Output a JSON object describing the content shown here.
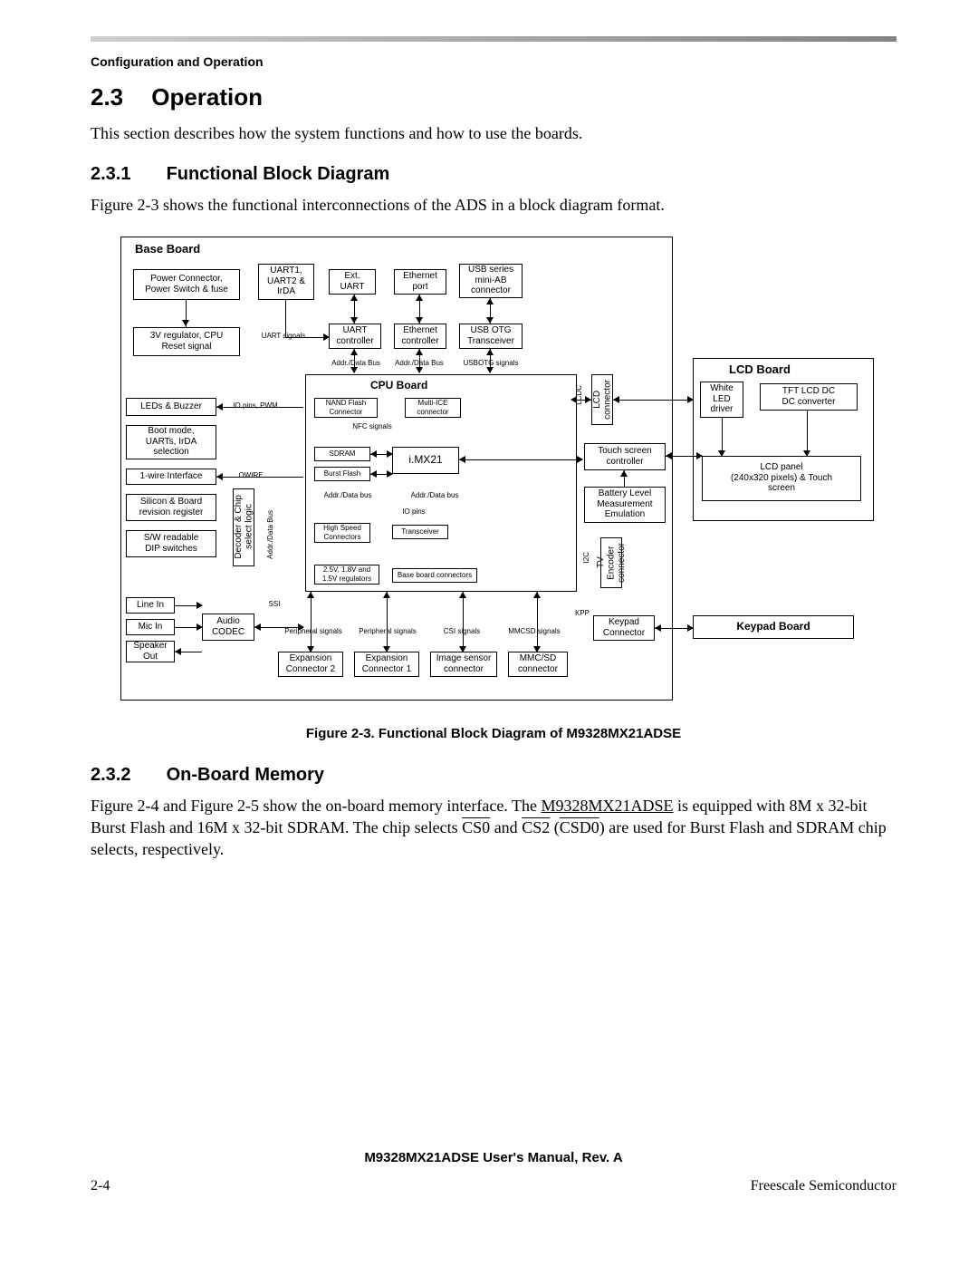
{
  "running_head": "Configuration and Operation",
  "sections": {
    "s23_num": "2.3",
    "s23_title": "Operation",
    "s23_body": "This section describes how the system functions and how to use the boards.",
    "s231_num": "2.3.1",
    "s231_title": "Functional Block Diagram",
    "s231_body": "Figure 2-3 shows the functional interconnections of the ADS in a block diagram format.",
    "s232_num": "2.3.2",
    "s232_title": "On-Board Memory",
    "s232_body_a": "Figure 2-4 and Figure 2-5 show the on-board memory interface. The ",
    "s232_body_b": "M9328MX21ADSE",
    "s232_body_c": " is equipped with 8M x 32-bit Burst Flash and 16M x 32-bit SDRAM. The chip selects ",
    "cs0": "CS0",
    "and": " and ",
    "cs2": "CS2",
    "lpar": " (",
    "csd0": "CSD0",
    "s232_body_d": ") are used for Burst Flash and SDRAM chip selects, respectively."
  },
  "figure_caption": "Figure 2-3.  Functional Block Diagram of M9328MX21ADSE",
  "footer": {
    "manual": "M9328MX21ADSE User's Manual, Rev. A",
    "page": "2-4",
    "company": "Freescale Semiconductor"
  },
  "diagram": {
    "base_board": "Base Board",
    "cpu_board": "CPU Board",
    "lcd_board": "LCD Board",
    "keypad_board": "Keypad Board",
    "blocks": {
      "power_conn": "Power Connector,\nPower Switch & fuse",
      "reg_3v": "3V regulator, CPU\nReset signal",
      "uart12_irda": "UART1,\nUART2 &\nIrDA",
      "ext_uart": "Ext.\nUART",
      "eth_port": "Ethernet\nport",
      "usb_miniab": "USB series\nmini-AB\nconnector",
      "uart_ctrl": "UART\ncontroller",
      "eth_ctrl": "Ethernet\ncontroller",
      "usb_otg": "USB OTG\nTransceiver",
      "leds_buzzer": "LEDs & Buzzer",
      "boot_mode": "Boot mode,\nUARTs, IrDA\nselection",
      "one_wire": "1-wire Interface",
      "silicon_rev": "Silicon & Board\nrevision register",
      "dip_sw": "S/W readable\nDIP switches",
      "line_in": "Line In",
      "mic_in": "Mic In",
      "spk_out": "Speaker\nOut",
      "audio_codec": "Audio\nCODEC",
      "decoder": "Decoder & Chip\nselect logic",
      "nand_flash": "NAND Flash\nConnector",
      "multi_ice": "Multi-ICE\nconnector",
      "sdram": "SDRAM",
      "burst_flash": "Burst Flash",
      "imx21": "i.MX21",
      "hs_conn": "High Speed\nConnectors",
      "transceiver": "Transceiver",
      "regs_25": "2.5V, 1.8V and\n1.5V regulators",
      "baseboard_conn": "Base board connectors",
      "exp2": "Expansion\nConnector 2",
      "exp1": "Expansion\nConnector 1",
      "img_sensor": "Image sensor\nconnector",
      "mmc_sd": "MMC/SD\nconnector",
      "lcd_conn": "LCD\nconnector",
      "touch_ctrl": "Touch screen\ncontroller",
      "battery": "Battery Level\nMeasurement\nEmulation",
      "tv_enc": "TV\nEncoder\nconnector",
      "keypad_conn": "Keypad\nConnector",
      "white_led": "White\nLED\ndriver",
      "tft_dc": "TFT LCD DC\nDC converter",
      "lcd_panel": "LCD panel\n(240x320 pixels) & Touch\nscreen"
    },
    "signals": {
      "uart_sig": "UART signals",
      "addr_data": "Addr./Data Bus",
      "usb_otg_sig": "USBOTG signals",
      "io_pwm": "IO pins, PWM",
      "nfc": "NFC signals",
      "owire": "OWIRE",
      "addr_data2": "Addr./Data bus",
      "io_pins": "IO pins",
      "ssi": "SSI",
      "periph1": "Peripheral signals",
      "periph2": "Peripheral signals",
      "csi": "CSI signals",
      "mmcsd": "MMCSD signals",
      "kpp": "KPP",
      "lcdc": "LCDC",
      "i2c": "I2C",
      "addr_data3": "Addr./Data Bus"
    }
  }
}
